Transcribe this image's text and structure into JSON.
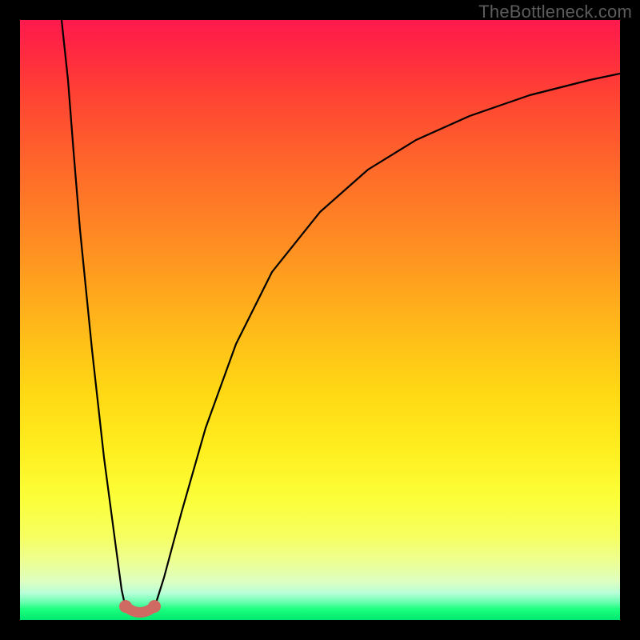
{
  "watermark": "TheBottleneck.com",
  "chart_data": {
    "type": "line",
    "title": "",
    "xlabel": "",
    "ylabel": "",
    "ylim": [
      0,
      100
    ],
    "xlim": [
      0,
      100
    ],
    "background_gradient": {
      "top_color": "#ff1a4d",
      "mid_color": "#ffd814",
      "bottom_color": "#00e86f",
      "meaning": "bottleneck severity (red=high, green=low)"
    },
    "series": [
      {
        "name": "left-branch",
        "x": [
          7,
          8,
          9,
          10,
          12,
          14,
          16,
          17,
          17.6
        ],
        "y": [
          100,
          90,
          78,
          65,
          45,
          27,
          12,
          5,
          2
        ]
      },
      {
        "name": "valley-floor",
        "x": [
          17.6,
          18.5,
          20,
          21.5,
          22.4
        ],
        "y": [
          2,
          1.3,
          1.1,
          1.3,
          2
        ]
      },
      {
        "name": "right-branch",
        "x": [
          22.4,
          24,
          27,
          31,
          36,
          42,
          50,
          58,
          66,
          75,
          85,
          95,
          100
        ],
        "y": [
          2,
          7,
          18,
          32,
          46,
          58,
          68,
          75,
          80,
          84,
          87.5,
          90,
          91
        ]
      }
    ],
    "markers": [
      {
        "name": "valley-end-left",
        "x": 17.6,
        "y": 2.0,
        "color": "#cc6666"
      },
      {
        "name": "valley-end-right",
        "x": 22.4,
        "y": 2.0,
        "color": "#cc6666"
      }
    ],
    "valley_segment": {
      "x_start": 17.6,
      "x_end": 22.4,
      "color": "#cc6666",
      "stroke_width_px": 12
    },
    "optimal_x": 20
  }
}
